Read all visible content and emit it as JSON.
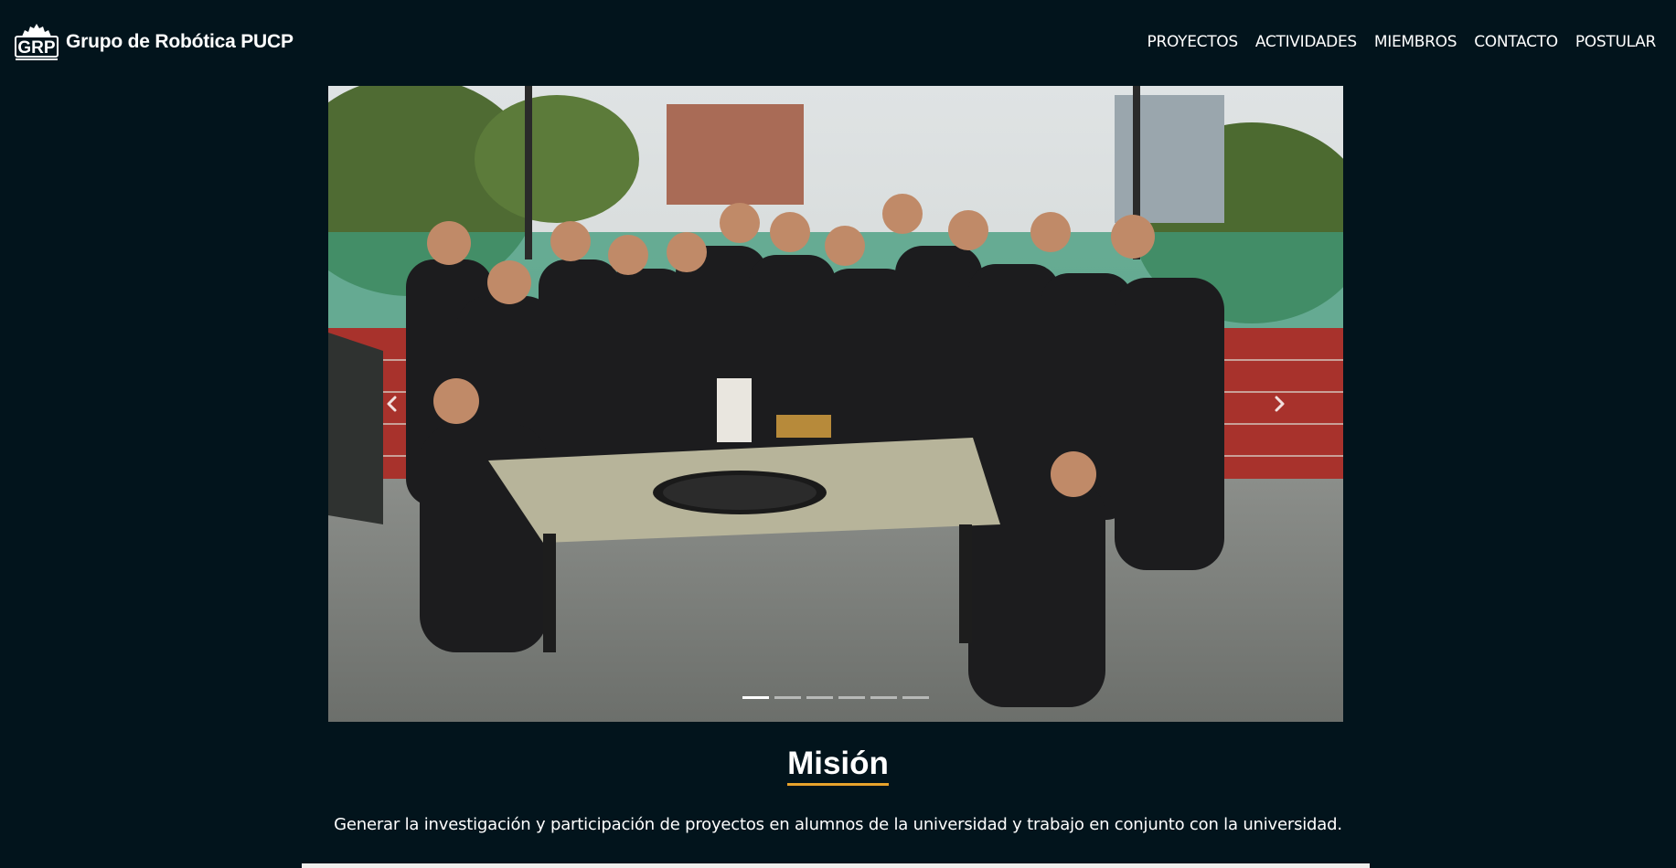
{
  "brand": {
    "name": "Grupo de Robótica PUCP",
    "logo_letters": "GRP",
    "logo_icon": "grp-gear-logo"
  },
  "nav": {
    "items": [
      {
        "label": "PROYECTOS"
      },
      {
        "label": "ACTIVIDADES"
      },
      {
        "label": "MIEMBROS"
      },
      {
        "label": "CONTACTO"
      },
      {
        "label": "POSTULAR"
      }
    ]
  },
  "carousel": {
    "slide_count": 6,
    "active_index": 0,
    "photo_description": "group-photo-icon",
    "prev_icon": "chevron-left-icon",
    "next_icon": "chevron-right-icon"
  },
  "mission": {
    "title": "Misión",
    "text": "Generar la investigación y participación de proyectos en alumnos de la universidad y trabajo en conjunto con la universidad."
  },
  "colors": {
    "background": "#02141c",
    "text": "#ffffff",
    "accent_underline": "#e8a32c"
  }
}
